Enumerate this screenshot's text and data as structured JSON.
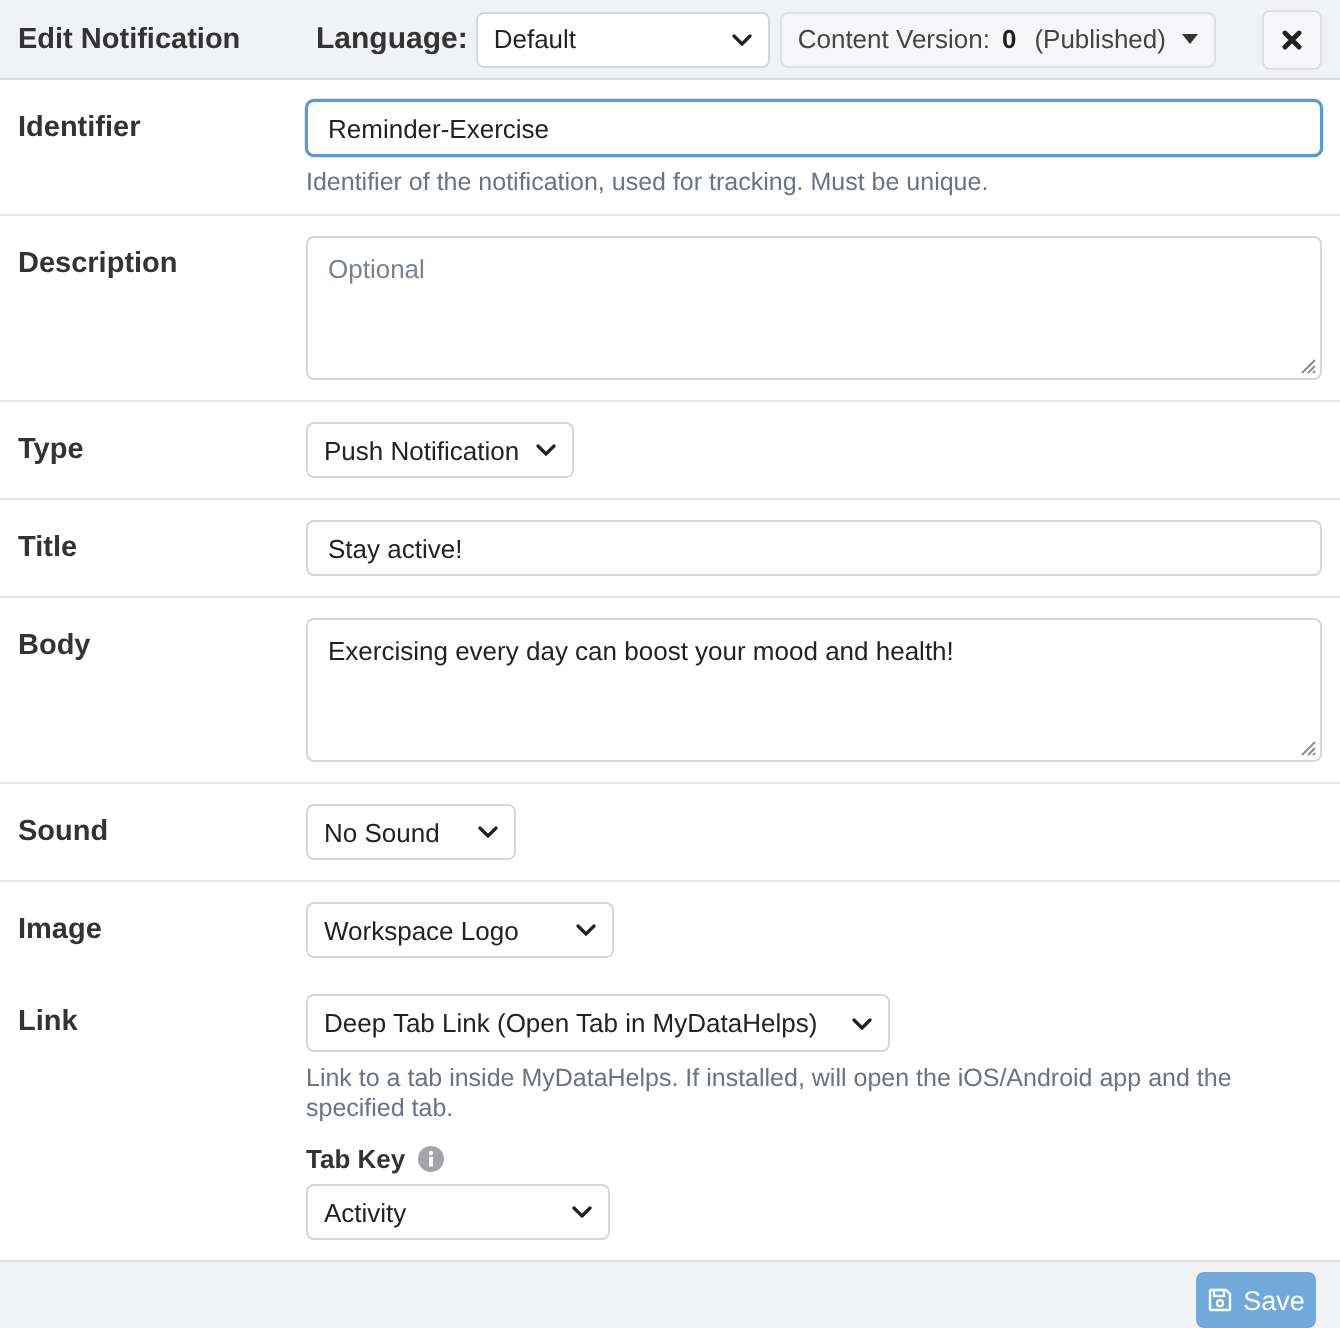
{
  "header": {
    "title": "Edit Notification",
    "language": {
      "label": "Language:",
      "value": "Default"
    },
    "content_version": {
      "label": "Content Version:",
      "number": "0",
      "status": "(Published)"
    }
  },
  "fields": [
    {
      "kind": "input",
      "label": "Identifier",
      "value": "Reminder-Exercise",
      "focused": true,
      "help": "Identifier of the notification, used for tracking. Must be unique."
    },
    {
      "kind": "textarea",
      "label": "Description",
      "placeholder": "Optional",
      "focused": false
    },
    {
      "kind": "select",
      "label": "Type",
      "value": "Push Notification",
      "focused": false
    },
    {
      "kind": "input",
      "label": "Title",
      "value": "Stay active!",
      "focused": false
    },
    {
      "kind": "textarea",
      "label": "Body",
      "value": "Exercising every day can boost your mood and health!",
      "focused": false
    },
    {
      "kind": "select",
      "label": "Sound",
      "value": "No Sound",
      "focused": false
    },
    {
      "kind": "select",
      "label": "Image",
      "value": "Workspace Logo",
      "focused": false
    },
    {
      "kind": "select",
      "label": "Link",
      "value": "Deep Tab Link (Open Tab in MyDataHelps)",
      "focused": false,
      "help": "Link to a tab inside MyDataHelps. If installed, will open the iOS/Android app and the specified tab.",
      "sub_field": {
        "label": "Tab Key",
        "value": "Activity"
      }
    }
  ],
  "footer": {
    "save_button": {
      "label": "Save",
      "disabled": true
    }
  }
}
